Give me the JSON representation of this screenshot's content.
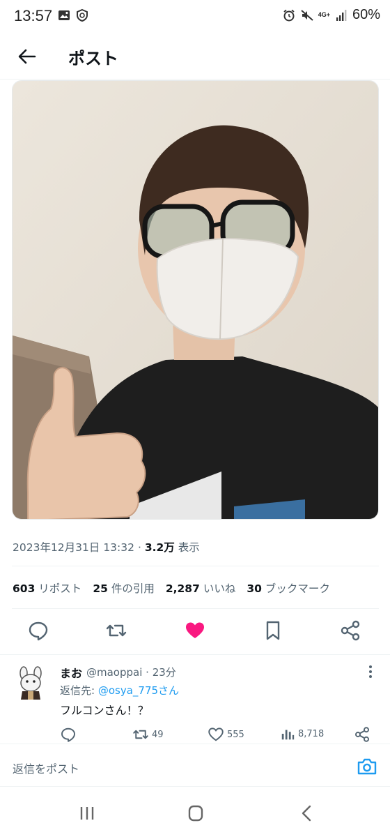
{
  "status_bar": {
    "time": "13:57",
    "network": "4G+",
    "battery": "60%",
    "icons": [
      "gallery-icon",
      "shield-icon",
      "alarm-icon",
      "mute-icon",
      "signal-icon"
    ]
  },
  "header": {
    "title": "ポスト",
    "back_icon": "arrow-left-icon"
  },
  "post": {
    "photo_alt": "selfie-photo",
    "date": "2023年12月31日 13:32",
    "separator": "·",
    "views": "3.2万",
    "views_label": "表示",
    "stats": [
      {
        "count": "603",
        "label": "リポスト"
      },
      {
        "count": "25",
        "label": "件の引用"
      },
      {
        "count": "2,287",
        "label": "いいね"
      },
      {
        "count": "30",
        "label": "ブックマーク"
      }
    ],
    "liked": true,
    "colors": {
      "like": "#f91880",
      "link": "#1d9bf0",
      "muted": "#536471",
      "text": "#0f1419"
    }
  },
  "reply": {
    "name": "まお",
    "handle": "@maoppai · 23分",
    "reply_to_label": "返信先:",
    "reply_to_handle": "@osya_775さん",
    "text": "フルコンさん！？",
    "retweets": "49",
    "likes": "555",
    "views": "8,718"
  },
  "composer": {
    "placeholder": "返信をポスト"
  }
}
